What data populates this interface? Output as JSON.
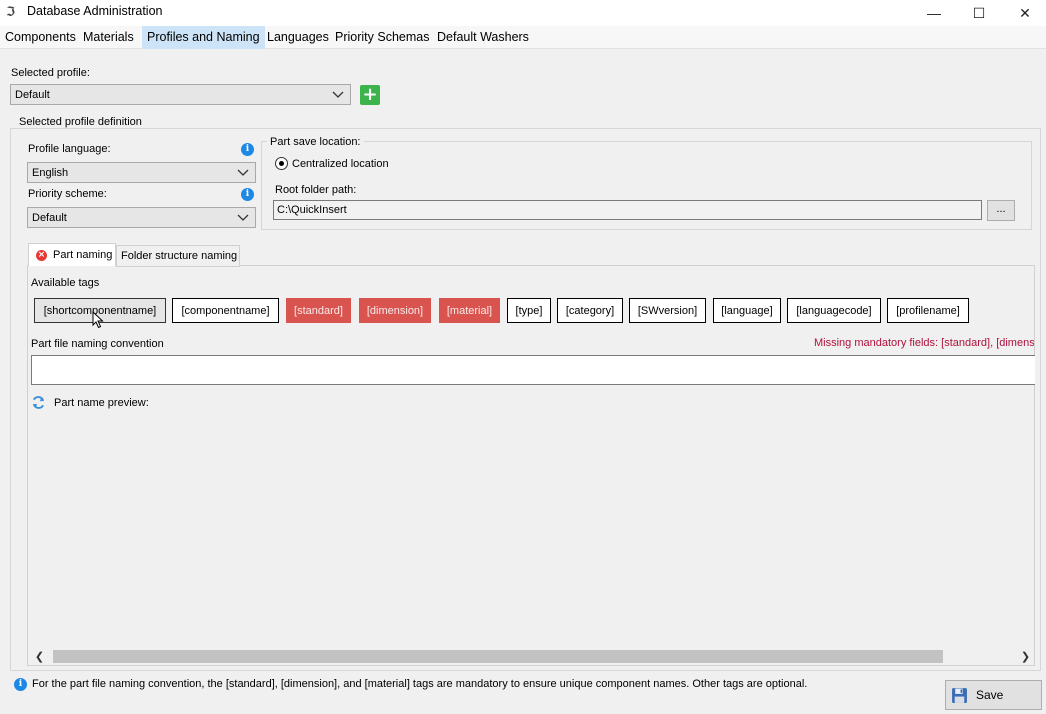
{
  "window": {
    "title": "Database Administration",
    "minimize_glyph": "—",
    "maximize_glyph": "☐",
    "close_glyph": "✕"
  },
  "main_tabs": [
    {
      "label": "Components"
    },
    {
      "label": "Materials"
    },
    {
      "label": "Profiles and Naming",
      "active": true
    },
    {
      "label": "Languages"
    },
    {
      "label": "Priority Schemas"
    },
    {
      "label": "Default Washers"
    }
  ],
  "selected_profile": {
    "label": "Selected profile:",
    "value": "Default",
    "add_icon": "plus-icon"
  },
  "definition": {
    "legend": "Selected profile definition",
    "profile_language": {
      "label": "Profile language:",
      "value": "English"
    },
    "priority_scheme": {
      "label": "Priority scheme:",
      "value": "Default"
    },
    "info_glyph": "i"
  },
  "save_location": {
    "legend": "Part save location:",
    "radio_label": "Centralized location",
    "radio_selected": true,
    "root_label": "Root folder path:",
    "root_value": "C:\\QuickInsert",
    "browse_label": "..."
  },
  "sub_tabs": [
    {
      "label": "Part naming",
      "active": true,
      "icon": "error-icon"
    },
    {
      "label": "Folder structure naming"
    }
  ],
  "part_naming": {
    "available_tags_label": "Available tags",
    "tags": [
      {
        "label": "[shortcomponentname]",
        "state": "hover"
      },
      {
        "label": "[componentname]",
        "state": "normal"
      },
      {
        "label": "[standard]",
        "state": "missing"
      },
      {
        "label": "[dimension]",
        "state": "missing"
      },
      {
        "label": "[material]",
        "state": "missing"
      },
      {
        "label": "[type]",
        "state": "normal"
      },
      {
        "label": "[category]",
        "state": "normal"
      },
      {
        "label": "[SWversion]",
        "state": "normal"
      },
      {
        "label": "[language]",
        "state": "normal"
      },
      {
        "label": "[languagecode]",
        "state": "normal"
      },
      {
        "label": "[profilename]",
        "state": "normal"
      }
    ],
    "convention_label": "Part file naming convention",
    "missing_message": "Missing mandatory fields: [standard], [dimension], [material]",
    "convention_value": "",
    "preview_label": "Part name preview:",
    "refresh_icon": "refresh-icon"
  },
  "footer": {
    "info_text": "For the part file naming convention, the [standard], [dimension], and [material] tags are mandatory to ensure unique component names. Other tags are optional.",
    "save_label": "Save",
    "save_icon": "floppy-disk-icon"
  },
  "colors": {
    "accent_tab": "#cde3f7",
    "missing_tag": "#d9534f",
    "missing_text": "#b0113d",
    "add_button": "#3cb44b",
    "info_icon": "#1e88e5"
  }
}
